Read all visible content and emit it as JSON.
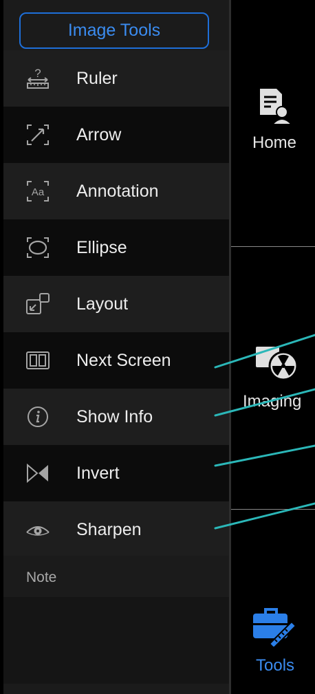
{
  "panel": {
    "title": "Image Tools",
    "items": [
      {
        "label": "Ruler",
        "icon": "ruler-icon"
      },
      {
        "label": "Arrow",
        "icon": "arrow-icon"
      },
      {
        "label": "Annotation",
        "icon": "annotation-icon"
      },
      {
        "label": "Ellipse",
        "icon": "ellipse-icon"
      },
      {
        "label": "Layout",
        "icon": "layout-icon"
      },
      {
        "label": "Next Screen",
        "icon": "next-screen-icon"
      },
      {
        "label": "Show Info",
        "icon": "info-icon"
      },
      {
        "label": "Invert",
        "icon": "invert-icon"
      },
      {
        "label": "Sharpen",
        "icon": "eye-icon"
      }
    ],
    "note_label": "Note"
  },
  "nav": {
    "items": [
      {
        "label": "Home",
        "icon": "home-document-icon"
      },
      {
        "label": "Imaging",
        "icon": "imaging-radiation-icon"
      },
      {
        "label": "Tools",
        "icon": "tools-briefcase-icon",
        "active": true
      }
    ]
  },
  "colors": {
    "accent": "#1e6fd9",
    "annotation_lines": "#2bb7b8",
    "panel_bg": "#1b1b1b",
    "row_dark": "#0c0c0c"
  }
}
